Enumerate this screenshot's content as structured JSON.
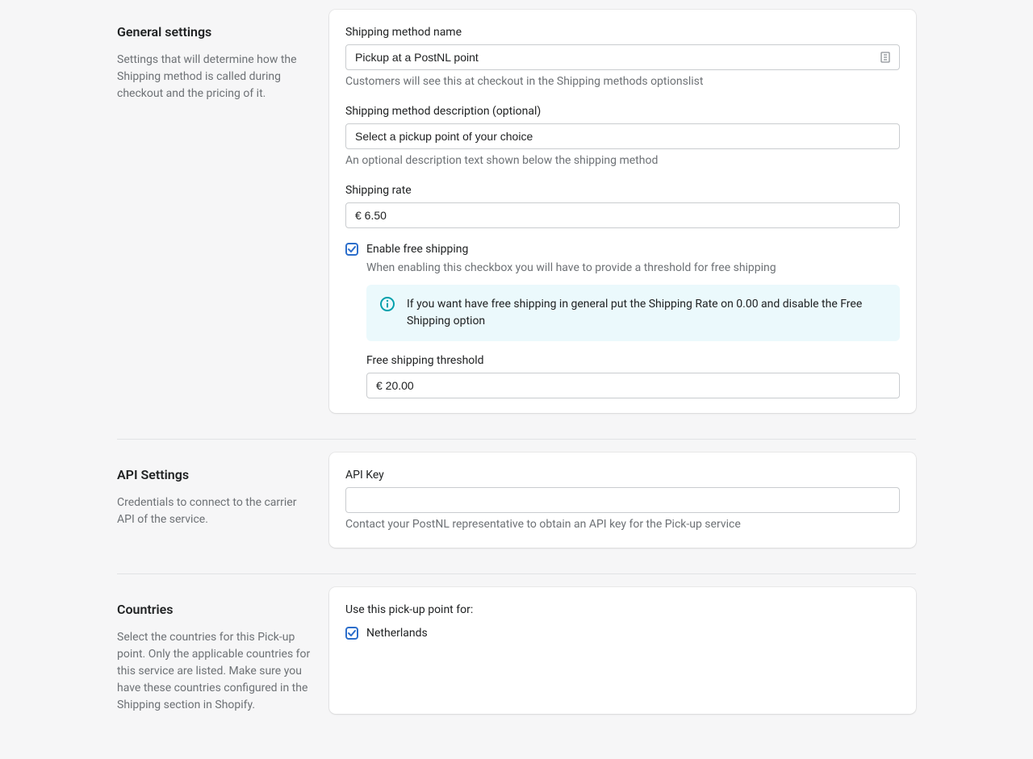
{
  "general": {
    "title": "General settings",
    "desc": "Settings that will determine how the Shipping method is called during checkout and the pricing of it.",
    "methodName": {
      "label": "Shipping method name",
      "value": "Pickup at a PostNL point",
      "help": "Customers will see this at checkout in the Shipping methods optionslist"
    },
    "methodDesc": {
      "label": "Shipping method description (optional)",
      "value": "Select a pickup point of your choice",
      "help": "An optional description text shown below the shipping method"
    },
    "rate": {
      "label": "Shipping rate",
      "value": "€ 6.50"
    },
    "freeShipping": {
      "label": "Enable free shipping",
      "help": "When enabling this checkbox you will have to provide a threshold for free shipping",
      "banner": "If you want have free shipping in general put the Shipping Rate on 0.00 and disable the Free Shipping option",
      "threshold": {
        "label": "Free shipping threshold",
        "value": "€ 20.00"
      }
    }
  },
  "api": {
    "title": "API Settings",
    "desc": "Credentials to connect to the carrier API of the service.",
    "key": {
      "label": "API Key",
      "value": "",
      "help": "Contact your PostNL representative to obtain an API key for the Pick-up service"
    }
  },
  "countries": {
    "title": "Countries",
    "desc": "Select the countries for this Pick-up point. Only the applicable countries for this service are listed. Make sure you have these countries configured in the Shipping section in Shopify.",
    "intro": "Use this pick-up point for:",
    "items": [
      {
        "label": "Netherlands"
      }
    ]
  }
}
